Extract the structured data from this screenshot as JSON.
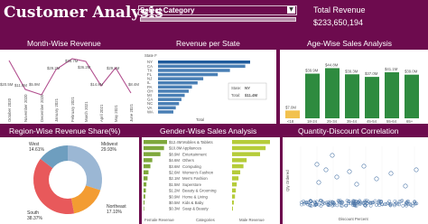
{
  "header": {
    "title": "Customer Analysis",
    "category_label": "Select Category",
    "total_label": "Total Revenue",
    "total_value": "$233,650,194"
  },
  "sections": {
    "month": "Month-Wise Revenue",
    "state": "Revenue per State",
    "age": "Age-Wise Sales Analysis",
    "region": "Region-Wise Revenue Share(%)",
    "gender": "Gender-Wise Sales Analysis",
    "quantity": "Quantity-Discount Correlation"
  },
  "month_chart": {
    "labels": [
      "$20.5M",
      "$11.8M",
      "$5.9M",
      "$29.2M",
      "$38.7M",
      "$36.2M",
      "$14.8M",
      "$29.1M",
      "$8.4M"
    ],
    "x_ticks": [
      "October 2020",
      "November 2020",
      "December 2020",
      "January 2021",
      "February 2021",
      "March 2021",
      "April 2021",
      "May 2021",
      "June 2021"
    ]
  },
  "state_chart": {
    "axis_label": "State F",
    "x_label": "Total",
    "states": [
      "NY",
      "CA",
      "TX",
      "FL",
      "NJ",
      "IL",
      "PA",
      "OH",
      "MI",
      "GA",
      "NC",
      "VA",
      "WA"
    ],
    "values": [
      11.4,
      10.8,
      8.9,
      7.4,
      5.6,
      4.9,
      4.2,
      3.8,
      3.3,
      2.9,
      2.6,
      2.2,
      1.9
    ],
    "tooltip_state_label": "State:",
    "tooltip_state": "NY",
    "tooltip_total_label": "Total:",
    "tooltip_total": "$11.4M"
  },
  "age_chart": {
    "categories": [
      "<18",
      "18-24",
      "25-34",
      "35-44",
      "45-54",
      "55-64",
      "65+"
    ],
    "values": [
      7.0,
      39.9,
      44.8,
      39.3,
      37.0,
      41.1,
      39.0
    ],
    "labels": [
      "$7.0M",
      "$39.9M",
      "$44.8M",
      "$39.3M",
      "$37.0M",
      "$41.1M",
      "$39.0M"
    ],
    "highlight_color": "#f2c14e",
    "bar_color": "#2e8b3f"
  },
  "region_chart": {
    "slices": [
      {
        "name": "Midwest",
        "pct": "29.93%",
        "value": 29.93,
        "color": "#9bb7d4"
      },
      {
        "name": "Northeast",
        "pct": "17.10%",
        "value": 17.1,
        "color": "#f39c32"
      },
      {
        "name": "South",
        "pct": "38.37%",
        "value": 38.37,
        "color": "#e8595b"
      },
      {
        "name": "West",
        "pct": "14.61%",
        "value": 14.61,
        "color": "#6e9ebf"
      }
    ]
  },
  "gender_chart": {
    "categories": [
      "Mobiles & Tablets",
      "Appliances",
      "Entertainment",
      "Others",
      "Computing",
      "Women's Fashion",
      "Men's Fashion",
      "Superstore",
      "Beauty & Grooming",
      "Home & Living",
      "Kids & Baby",
      "Soap & Beauty"
    ],
    "female": [
      "$12.4M",
      "$10.8M",
      "$8.9M",
      "$4.6M",
      "$3.6M",
      "$2.6M",
      "$2.1M",
      "$1.5M",
      "$1.2M",
      "$0.9M",
      "$0.5M",
      "$0.3M"
    ],
    "female_values": [
      12.4,
      10.8,
      8.9,
      4.6,
      3.6,
      2.6,
      2.1,
      1.5,
      1.2,
      0.9,
      0.5,
      0.3
    ],
    "male_values": [
      13.0,
      11.5,
      9.6,
      5.0,
      3.9,
      2.8,
      2.2,
      1.6,
      1.3,
      1.0,
      0.6,
      0.3
    ],
    "footer_female": "Female Revenue",
    "footer_cat": "Categories",
    "footer_male": "Male Revenue"
  },
  "quantity_chart": {
    "x_label": "Discount Percent",
    "y_label": "Qty Ordered",
    "x_ticks": [
      "0",
      "10",
      "20",
      "30",
      "40",
      "50",
      "60",
      "70"
    ],
    "y_ticks": [
      "1",
      "2",
      "3",
      "4",
      "5"
    ]
  }
}
